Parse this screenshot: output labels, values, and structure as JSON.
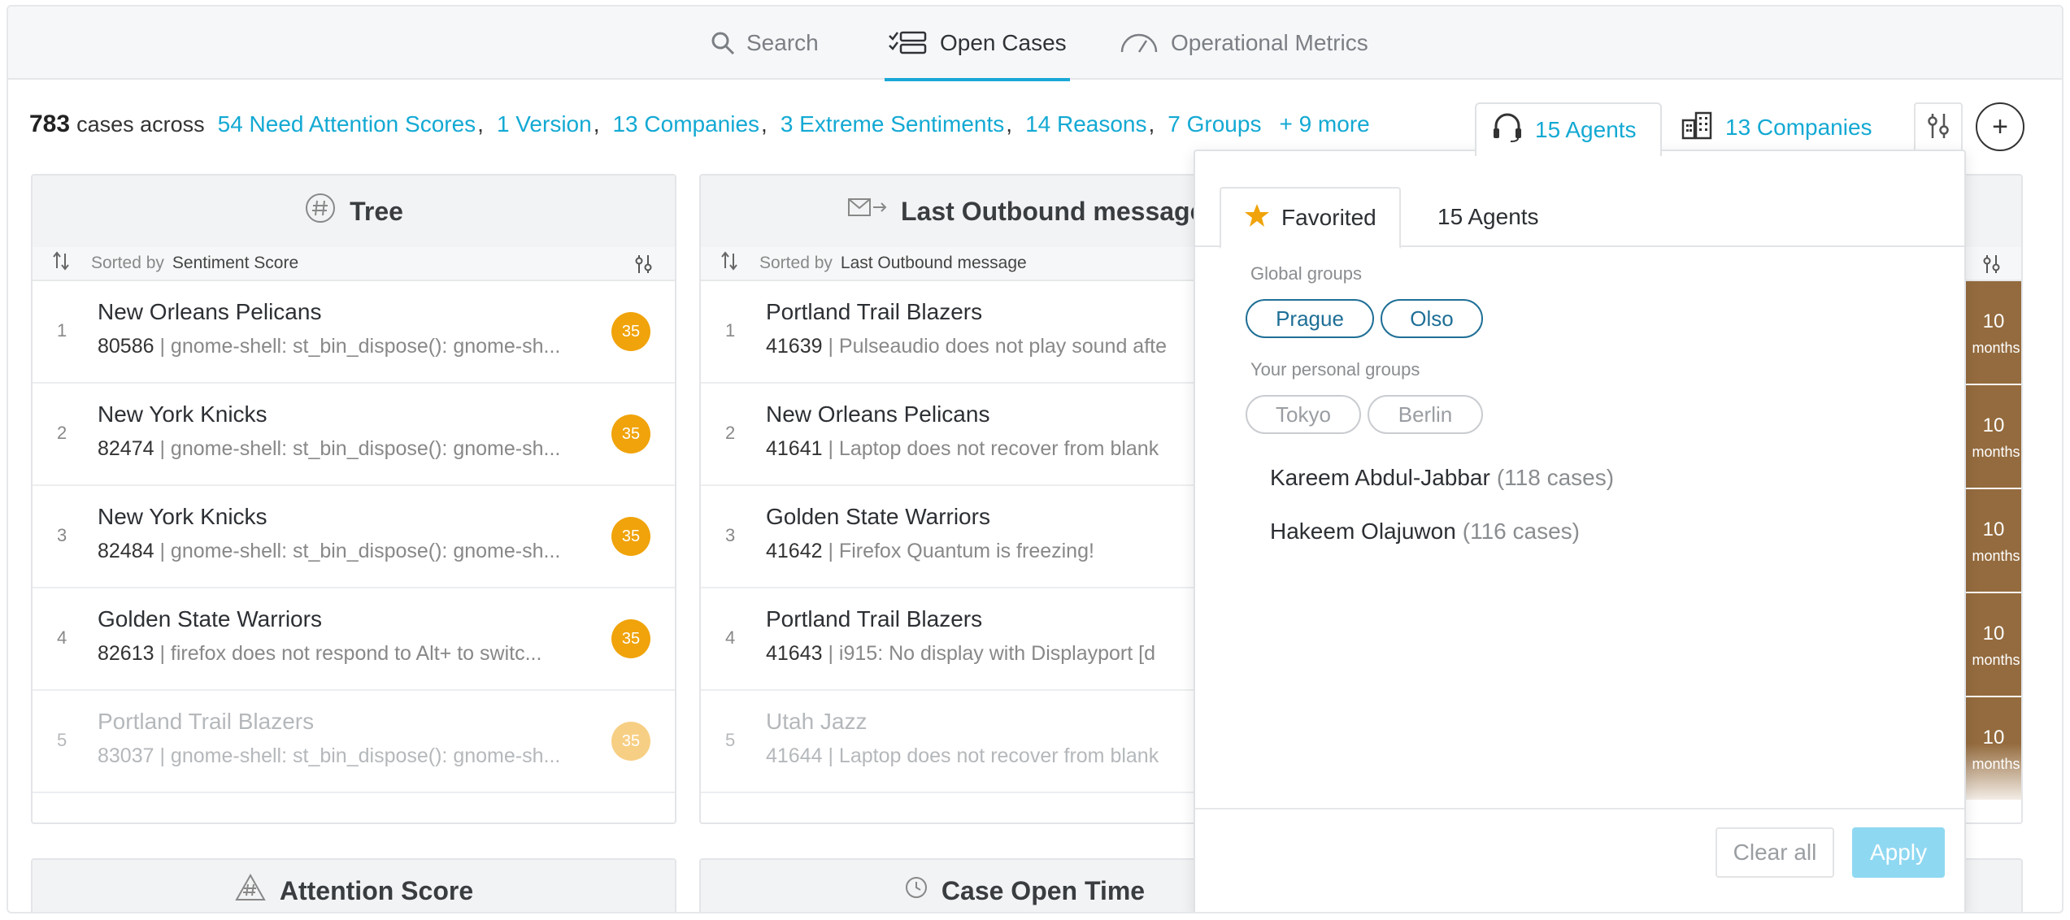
{
  "nav": {
    "tabs": [
      {
        "label": "Search",
        "icon": "search-icon"
      },
      {
        "label": "Open Cases",
        "icon": "open-cases-icon",
        "active": true
      },
      {
        "label": "Operational Metrics",
        "icon": "gauge-icon"
      }
    ]
  },
  "summary": {
    "count": "783",
    "across": "cases across",
    "filters": [
      "54 Need Attention Scores",
      "1 Version",
      "13 Companies",
      "3 Extreme Sentiments",
      "14 Reasons",
      "7 Groups"
    ],
    "more": "+ 9 more"
  },
  "toolbar": {
    "agents_label": "15 Agents",
    "companies_label": "13 Companies",
    "add_label": "+"
  },
  "cards": {
    "tree": {
      "title": "Tree",
      "sorted_by_label": "Sorted by",
      "sorted_by_field": "Sentiment Score",
      "rows": [
        {
          "num": "1",
          "title": "New Orleans Pelicans",
          "id": "80586",
          "desc": "| gnome-shell: st_bin_dispose(): gnome-sh...",
          "score": "35"
        },
        {
          "num": "2",
          "title": "New York Knicks",
          "id": "82474",
          "desc": "| gnome-shell: st_bin_dispose(): gnome-sh...",
          "score": "35"
        },
        {
          "num": "3",
          "title": "New York Knicks",
          "id": "82484",
          "desc": "| gnome-shell: st_bin_dispose(): gnome-sh...",
          "score": "35"
        },
        {
          "num": "4",
          "title": "Golden State Warriors",
          "id": "82613",
          "desc": "| firefox does not respond to Alt+ to switc...",
          "score": "35"
        },
        {
          "num": "5",
          "title": "Portland Trail Blazers",
          "id": "83037",
          "desc": "| gnome-shell: st_bin_dispose(): gnome-sh...",
          "score": "35"
        }
      ]
    },
    "outbound": {
      "title": "Last Outbound message",
      "sorted_by_label": "Sorted by",
      "sorted_by_field": "Last Outbound message",
      "rows": [
        {
          "num": "1",
          "title": "Portland Trail Blazers",
          "id": "41639",
          "desc": "| Pulseaudio does not play sound afte"
        },
        {
          "num": "2",
          "title": "New Orleans Pelicans",
          "id": "41641",
          "desc": "| Laptop does not recover from blank"
        },
        {
          "num": "3",
          "title": "Golden State Warriors",
          "id": "41642",
          "desc": "| Firefox Quantum is freezing!"
        },
        {
          "num": "4",
          "title": "Portland Trail Blazers",
          "id": "41643",
          "desc": "| i915: No display with Displayport [d"
        },
        {
          "num": "5",
          "title": "Utah Jazz",
          "id": "41644",
          "desc": "| Laptop does not recover from blank"
        }
      ]
    },
    "age_cells": [
      {
        "n": "10",
        "m": "months"
      },
      {
        "n": "10",
        "m": "months"
      },
      {
        "n": "10",
        "m": "months"
      },
      {
        "n": "10",
        "m": "months"
      },
      {
        "n": "10",
        "m": "months"
      }
    ],
    "bottom": [
      {
        "title": "Attention Score"
      },
      {
        "title": "Case Open Time"
      }
    ]
  },
  "dropdown": {
    "tabs": [
      "Favorited",
      "15 Agents"
    ],
    "global_label": "Global groups",
    "global_groups": [
      "Prague",
      "Olso"
    ],
    "personal_label": "Your personal groups",
    "personal_groups": [
      "Tokyo",
      "Berlin"
    ],
    "agents": [
      {
        "name": "Kareem Abdul-Jabbar",
        "cases": "(118 cases)"
      },
      {
        "name": "Hakeem Olajuwon",
        "cases": "(116 cases)"
      }
    ],
    "clear_label": "Clear all",
    "apply_label": "Apply"
  },
  "colors": {
    "accent": "#13a9d3",
    "badge": "#f0a30a",
    "age_cell": "#946b3e",
    "global_pill": "#1f6f96",
    "apply_disabled": "#8fd8f2"
  }
}
